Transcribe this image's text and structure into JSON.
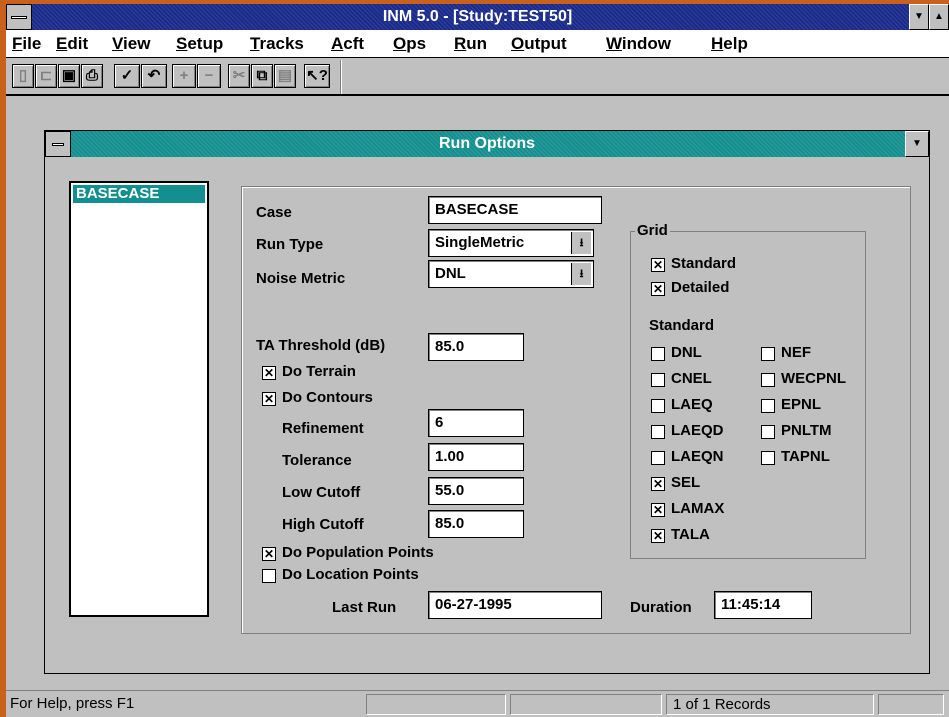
{
  "window": {
    "title": "INM 5.0 - [Study:TEST50]"
  },
  "menu": {
    "items": [
      "File",
      "Edit",
      "View",
      "Setup",
      "Tracks",
      "Acft",
      "Ops",
      "Run",
      "Output",
      "Window",
      "Help"
    ]
  },
  "toolbar": {
    "buttons": [
      "new-file-icon",
      "open-folder-icon",
      "save-disk-icon",
      "print-icon",
      "check-icon",
      "undo-icon",
      "add-icon",
      "remove-icon",
      "cut-icon",
      "copy-icon",
      "paste-icon",
      "context-help-icon"
    ]
  },
  "dialog": {
    "title": "Run Options",
    "case_list": [
      "BASECASE"
    ],
    "case": {
      "label": "Case",
      "value": "BASECASE"
    },
    "run_type": {
      "label": "Run Type",
      "value": "SingleMetric"
    },
    "noise_metric": {
      "label": "Noise Metric",
      "value": "DNL"
    },
    "ta_threshold": {
      "label": "TA Threshold (dB)",
      "value": "85.0"
    },
    "do_terrain": {
      "label": "Do Terrain",
      "checked": true
    },
    "do_contours": {
      "label": "Do Contours",
      "checked": true
    },
    "refinement": {
      "label": "Refinement",
      "value": "6"
    },
    "tolerance": {
      "label": "Tolerance",
      "value": "1.00"
    },
    "low_cutoff": {
      "label": "Low Cutoff",
      "value": "55.0"
    },
    "high_cutoff": {
      "label": "High Cutoff",
      "value": "85.0"
    },
    "do_population": {
      "label": "Do Population Points",
      "checked": true
    },
    "do_location": {
      "label": "Do Location Points",
      "checked": false
    },
    "last_run": {
      "label": "Last Run",
      "value": "06-27-1995"
    },
    "duration": {
      "label": "Duration",
      "value": "11:45:14"
    },
    "grid": {
      "legend": "Grid",
      "standard": {
        "label": "Standard",
        "checked": true
      },
      "detailed": {
        "label": "Detailed",
        "checked": true
      },
      "standard_heading": "Standard",
      "metrics_left": [
        {
          "label": "DNL",
          "checked": false
        },
        {
          "label": "CNEL",
          "checked": false
        },
        {
          "label": "LAEQ",
          "checked": false
        },
        {
          "label": "LAEQD",
          "checked": false
        },
        {
          "label": "LAEQN",
          "checked": false
        },
        {
          "label": "SEL",
          "checked": true
        },
        {
          "label": "LAMAX",
          "checked": true
        },
        {
          "label": "TALA",
          "checked": true
        }
      ],
      "metrics_right": [
        {
          "label": "NEF",
          "checked": false
        },
        {
          "label": "WECPNL",
          "checked": false
        },
        {
          "label": "EPNL",
          "checked": false
        },
        {
          "label": "PNLTM",
          "checked": false
        },
        {
          "label": "TAPNL",
          "checked": false
        }
      ]
    }
  },
  "status": {
    "help": "For Help, press F1",
    "records": "1 of 1  Records"
  }
}
